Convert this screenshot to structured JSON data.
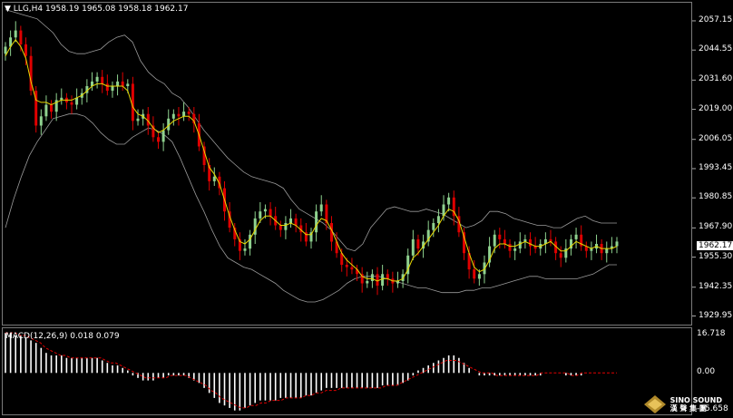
{
  "header": {
    "symbol_caret": "▼",
    "title": "LLG,H4  1958.19 1965.08 1958.18 1962.17"
  },
  "macd_header": "MACD(12,26,9) 0.018 0.079",
  "price_axis": [
    "2057.15",
    "2044.55",
    "2031.60",
    "2019.00",
    "2006.05",
    "1993.45",
    "1980.85",
    "1967.90",
    "1955.30",
    "1942.35",
    "1929.95"
  ],
  "current_price": "1962.17",
  "macd_axis": [
    "16.718",
    "0.00",
    "-15.658"
  ],
  "logo": {
    "line1": "SINO SOUND",
    "line2": "漢 聲 集 團"
  },
  "colors": {
    "up": "#8fd28f",
    "down": "#e00000",
    "bands": "#9a9a9a",
    "ma": "#e8d800",
    "hist": "#ffffff",
    "signal": "#e00000"
  },
  "chart_data": {
    "type": "candlestick",
    "title": "LLG,H4",
    "ohlc_header": [
      1958.19,
      1965.08,
      1958.18,
      1962.17
    ],
    "ylim": [
      1927,
      2063
    ],
    "macd_ylim": [
      -16.2,
      17.5
    ],
    "series": [
      {
        "name": "close",
        "values": [
          2046,
          2050,
          2053,
          2047,
          2042,
          2027,
          2012,
          2016,
          2021,
          2018,
          2023,
          2024,
          2022,
          2021,
          2024,
          2026,
          2029,
          2031,
          2033,
          2030,
          2027,
          2029,
          2031,
          2029,
          2030,
          2014,
          2015,
          2017,
          2012,
          2007,
          2005,
          2010,
          2015,
          2017,
          2016,
          2018,
          2017,
          2013,
          2003,
          1995,
          1988,
          1990,
          1985,
          1975,
          1968,
          1963,
          1958,
          1959,
          1965,
          1972,
          1975,
          1976,
          1973,
          1969,
          1967,
          1970,
          1972,
          1969,
          1966,
          1962,
          1966,
          1975,
          1978,
          1970,
          1962,
          1957,
          1952,
          1951,
          1950,
          1948,
          1944,
          1945,
          1948,
          1943,
          1948,
          1946,
          1944,
          1945,
          1948,
          1956,
          1963,
          1959,
          1962,
          1967,
          1970,
          1973,
          1978,
          1981,
          1973,
          1966,
          1957,
          1950,
          1946,
          1948,
          1953,
          1960,
          1965,
          1963,
          1961,
          1958,
          1959,
          1962,
          1963,
          1960,
          1959,
          1961,
          1963,
          1962,
          1957,
          1955,
          1959,
          1963,
          1965,
          1960,
          1958,
          1959,
          1961,
          1957,
          1959,
          1960,
          1962
        ]
      },
      {
        "name": "upper_band",
        "values": [
          2062,
          2061,
          2060,
          2059,
          2058,
          2055,
          2052,
          2047,
          2044,
          2043,
          2043,
          2044,
          2045,
          2048,
          2050,
          2051,
          2048,
          2040,
          2035,
          2032,
          2030,
          2026,
          2024,
          2020,
          2015,
          2010,
          2006,
          2002,
          1998,
          1995,
          1992,
          1990,
          1989,
          1988,
          1987,
          1985,
          1980,
          1976,
          1974,
          1972,
          1970,
          1967,
          1963,
          1959,
          1958,
          1961,
          1968,
          1972,
          1976,
          1977,
          1976,
          1975,
          1975,
          1976,
          1975,
          1974,
          1972,
          1970,
          1968,
          1969,
          1971,
          1975,
          1975,
          1974,
          1972,
          1971,
          1970,
          1969,
          1969,
          1968,
          1968,
          1970,
          1972,
          1973,
          1971,
          1970,
          1970,
          1970
        ]
      },
      {
        "name": "lower_band",
        "values": [
          1968,
          1980,
          1990,
          1999,
          2005,
          2010,
          2015,
          2016,
          2017,
          2017,
          2016,
          2013,
          2009,
          2006,
          2004,
          2004,
          2007,
          2009,
          2011,
          2010,
          2008,
          2005,
          1998,
          1990,
          1982,
          1975,
          1967,
          1960,
          1955,
          1953,
          1951,
          1950,
          1948,
          1946,
          1944,
          1941,
          1939,
          1937,
          1936,
          1936,
          1937,
          1939,
          1941,
          1944,
          1946,
          1947,
          1947,
          1947,
          1946,
          1945,
          1944,
          1943,
          1942,
          1942,
          1941,
          1940,
          1940,
          1940,
          1941,
          1941,
          1942,
          1942,
          1943,
          1944,
          1945,
          1946,
          1947,
          1947,
          1946,
          1946,
          1946,
          1946,
          1946,
          1947,
          1948,
          1950,
          1952,
          1952
        ]
      },
      {
        "name": "ma",
        "values": [
          2042,
          2046,
          2049,
          2046,
          2041,
          2031,
          2023,
          2022,
          2022,
          2021,
          2022,
          2023,
          2023,
          2023,
          2024,
          2025,
          2027,
          2029,
          2030,
          2030,
          2029,
          2029,
          2029,
          2029,
          2027,
          2020,
          2017,
          2016,
          2014,
          2011,
          2009,
          2010,
          2012,
          2014,
          2015,
          2016,
          2016,
          2014,
          2008,
          2001,
          1994,
          1991,
          1987,
          1980,
          1973,
          1967,
          1962,
          1961,
          1963,
          1967,
          1971,
          1973,
          1973,
          1971,
          1969,
          1969,
          1970,
          1969,
          1967,
          1965,
          1965,
          1969,
          1972,
          1971,
          1967,
          1962,
          1957,
          1954,
          1952,
          1950,
          1947,
          1946,
          1946,
          1945,
          1946,
          1946,
          1945,
          1945,
          1946,
          1950,
          1955,
          1957,
          1960,
          1963,
          1966,
          1969,
          1973,
          1976,
          1975,
          1971,
          1964,
          1957,
          1951,
          1949,
          1950,
          1954,
          1959,
          1961,
          1961,
          1960,
          1960,
          1961,
          1962,
          1961,
          1960,
          1960,
          1961,
          1962,
          1960,
          1958,
          1958,
          1960,
          1962,
          1961,
          1960,
          1959,
          1960,
          1959,
          1959,
          1959,
          1960
        ]
      },
      {
        "name": "macd_histogram",
        "values": [
          16,
          16,
          15,
          15,
          14,
          13,
          12,
          10,
          8,
          7,
          7,
          7,
          6,
          6,
          6,
          6,
          6,
          6,
          6,
          5,
          4,
          3,
          3,
          2,
          1,
          -1,
          -2,
          -3,
          -3,
          -3,
          -2,
          -2,
          -1,
          -1,
          -1,
          -1,
          -2,
          -3,
          -4,
          -6,
          -8,
          -10,
          -12,
          -13,
          -14,
          -15,
          -15,
          -14,
          -13,
          -12,
          -11,
          -11,
          -11,
          -11,
          -10,
          -10,
          -10,
          -10,
          -10,
          -9,
          -9,
          -8,
          -7,
          -6,
          -6,
          -6,
          -6,
          -6,
          -6,
          -6,
          -6,
          -6,
          -6,
          -6,
          -5,
          -5,
          -5,
          -5,
          -4,
          -3,
          -1,
          1,
          2,
          3,
          4,
          5,
          6,
          7,
          7,
          6,
          4,
          2,
          0,
          -1,
          -1,
          -1,
          -1,
          -1,
          -1,
          -1,
          -1,
          -1,
          -1,
          -1,
          -1,
          -1,
          0,
          0,
          0,
          0,
          -1,
          -1,
          -1,
          -1,
          0,
          0,
          0,
          0,
          0,
          0,
          0
        ]
      },
      {
        "name": "macd_signal",
        "values": [
          16,
          16,
          16,
          15,
          15,
          14,
          13,
          12,
          10,
          9,
          8,
          7,
          7,
          6,
          6,
          6,
          6,
          6,
          6,
          6,
          5,
          4,
          4,
          3,
          2,
          1,
          0,
          -1,
          -2,
          -2,
          -2,
          -2,
          -2,
          -1,
          -1,
          -1,
          -1,
          -2,
          -3,
          -4,
          -5,
          -7,
          -8,
          -10,
          -11,
          -12,
          -13,
          -14,
          -14,
          -13,
          -13,
          -12,
          -12,
          -11,
          -11,
          -11,
          -10,
          -10,
          -10,
          -10,
          -9,
          -9,
          -8,
          -8,
          -7,
          -7,
          -7,
          -6,
          -6,
          -6,
          -6,
          -6,
          -6,
          -6,
          -6,
          -6,
          -5,
          -5,
          -5,
          -4,
          -3,
          -2,
          -1,
          0,
          1,
          2,
          3,
          4,
          5,
          5,
          5,
          4,
          3,
          2,
          1,
          0,
          0,
          0,
          -1,
          -1,
          -1,
          -1,
          -1,
          -1,
          -1,
          -1,
          -1,
          0,
          0,
          0,
          0,
          0,
          0,
          -1,
          -1,
          0,
          0,
          0,
          0,
          0,
          0,
          0,
          0
        ]
      }
    ]
  }
}
